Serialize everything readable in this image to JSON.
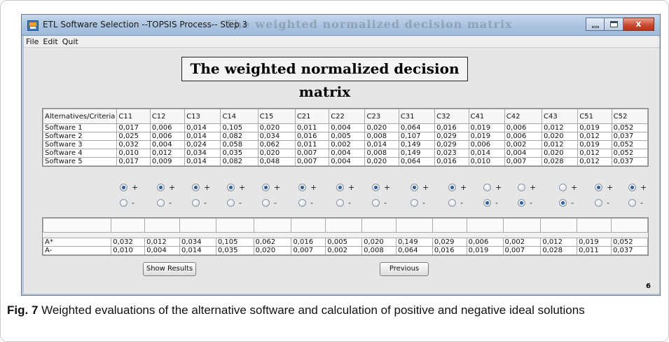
{
  "window": {
    "title": "ETL Software Selection --TOPSIS Process-- Step 3",
    "ghost_title": "The weighted normalized decision matrix",
    "close_glyph": "x"
  },
  "menu": [
    "File",
    "Edit",
    "Quit"
  ],
  "heading": "The weighted normalized decision matrix",
  "decision_table": {
    "headers": [
      "Alternatives/Criteria",
      "C11",
      "C12",
      "C13",
      "C14",
      "C15",
      "C21",
      "C22",
      "C23",
      "C31",
      "C32",
      "C41",
      "C42",
      "C43",
      "C51",
      "C52"
    ],
    "rows": [
      [
        "Software 1",
        "0,017",
        "0,006",
        "0,014",
        "0,105",
        "0,020",
        "0,011",
        "0,004",
        "0,020",
        "0,064",
        "0,016",
        "0,019",
        "0,006",
        "0,012",
        "0,019",
        "0,052"
      ],
      [
        "Software 2",
        "0,025",
        "0,006",
        "0,014",
        "0,082",
        "0,034",
        "0,016",
        "0,005",
        "0,008",
        "0,107",
        "0,029",
        "0,019",
        "0,006",
        "0,020",
        "0,012",
        "0,037"
      ],
      [
        "Software 3",
        "0,032",
        "0,004",
        "0,024",
        "0,058",
        "0,062",
        "0,011",
        "0,002",
        "0,014",
        "0,149",
        "0,029",
        "0,006",
        "0,002",
        "0,012",
        "0,019",
        "0,052"
      ],
      [
        "Software 4",
        "0,010",
        "0,012",
        "0,034",
        "0,035",
        "0,020",
        "0,007",
        "0,004",
        "0,008",
        "0,149",
        "0,023",
        "0,014",
        "0,004",
        "0,020",
        "0,012",
        "0,052"
      ],
      [
        "Software 5",
        "0,017",
        "0,009",
        "0,014",
        "0,082",
        "0,048",
        "0,007",
        "0,004",
        "0,020",
        "0,064",
        "0,016",
        "0,010",
        "0,007",
        "0,028",
        "0,012",
        "0,037"
      ]
    ]
  },
  "radio_labels": {
    "plus": "+",
    "minus": "-"
  },
  "criteria_selection": [
    "+",
    "+",
    "+",
    "+",
    "+",
    "+",
    "+",
    "+",
    "+",
    "+",
    "-",
    "-",
    "-",
    "+",
    "+"
  ],
  "ideal_table": {
    "rows": [
      [
        "A*",
        "0,032",
        "0,012",
        "0,034",
        "0,105",
        "0,062",
        "0,016",
        "0,005",
        "0,020",
        "0,149",
        "0,029",
        "0,006",
        "0,002",
        "0,012",
        "0,019",
        "0,052"
      ],
      [
        "A-",
        "0,010",
        "0,004",
        "0,014",
        "0,035",
        "0,020",
        "0,007",
        "0,002",
        "0,008",
        "0,064",
        "0,016",
        "0,019",
        "0,007",
        "0,028",
        "0,011",
        "0,037"
      ]
    ]
  },
  "buttons": {
    "show_results": "Show Results",
    "previous": "Previous"
  },
  "page_number": "6",
  "caption": {
    "label": "Fig. 7",
    "text": "Weighted evaluations of the alternative software and calculation of positive and negative ideal solutions"
  }
}
